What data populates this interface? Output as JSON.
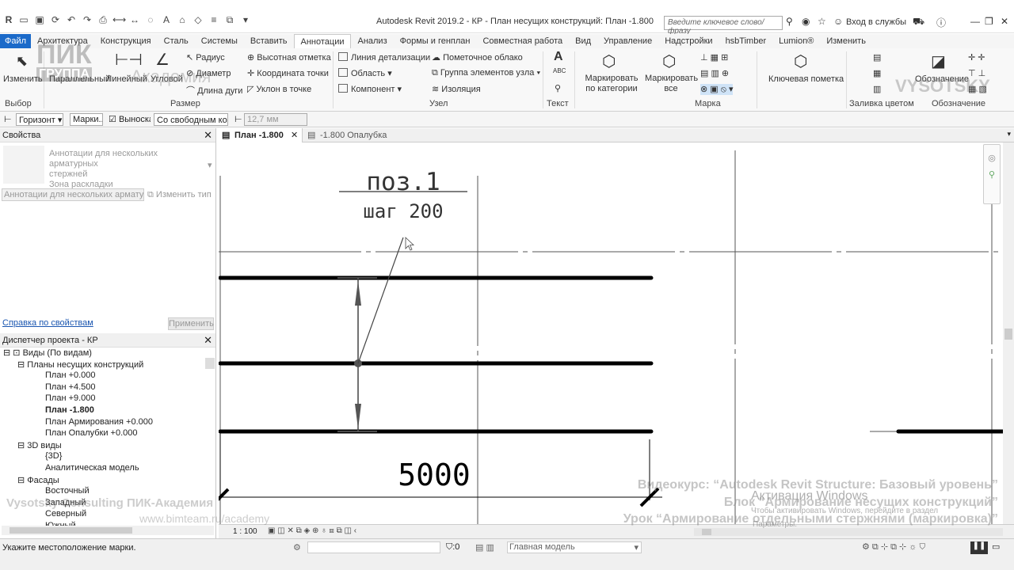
{
  "window": {
    "title": "Autodesk Revit 2019.2 - КР - План несущих конструкций: План -1.800",
    "search_placeholder": "Введите ключевое слово/фразу",
    "login": "Вход в службы"
  },
  "ribbon_tabs": [
    "Файл",
    "Архитектура",
    "Конструкция",
    "Сталь",
    "Системы",
    "Вставить",
    "Аннотации",
    "Анализ",
    "Формы и генплан",
    "Совместная работа",
    "Вид",
    "Управление",
    "Надстройки",
    "hsbTimber",
    "Lumion®",
    "Изменить"
  ],
  "ribbon": {
    "select": {
      "label": "Изменить",
      "section": "Выбор"
    },
    "dimension": {
      "aligned": "Параллельный",
      "linear": "Линейный",
      "angular": "Угловой",
      "radius": "Радиус",
      "diameter": "Диаметр",
      "arc_length": "Длина дуги",
      "spot_elevation": "Высотная отметка",
      "spot_coordinate": "Координата точки",
      "spot_slope": "Уклон в точке",
      "section": "Размер"
    },
    "detail": {
      "detail_line": "Линия детализации",
      "region": "Область",
      "component": "Компонент",
      "revision_cloud": "Пометочное облако",
      "detail_group": "Группа элементов узла",
      "insulation": "Изоляция",
      "section": "Узел"
    },
    "text": {
      "section": "Текст"
    },
    "tag": {
      "by_category": "Маркировать по категории",
      "all": "Маркировать все",
      "section": "Марка"
    },
    "keynote": {
      "label": "Ключевая пометка"
    },
    "color_fill": {
      "section": "Заливка цветом"
    },
    "symbol": {
      "label": "Обозначение",
      "section": "Обозначение"
    }
  },
  "options_bar": {
    "orientation": "Горизонт",
    "tags": "Марки...",
    "leader_label": "Выноска",
    "leader_type": "Со свободным ко",
    "length": "12,7 мм"
  },
  "properties": {
    "title": "Свойства",
    "type_line1": "Аннотации для нескольких арматурных",
    "type_line2": "стержней",
    "type_line3": "Зона раскладки",
    "selector": "Аннотации для нескольких арматур",
    "edit_type": "Изменить тип",
    "help": "Справка по свойствам",
    "apply": "Применить"
  },
  "browser": {
    "title": "Диспетчер проекта - КР",
    "items": [
      "Виды (По видам)",
      "Планы несущих конструкций",
      "План +0.000",
      "План +4.500",
      "План +9.000",
      "План -1.800",
      "План Армирования +0.000",
      "План Опалубки +0.000",
      "3D виды",
      "{3D}",
      "Аналитическая модель",
      "Фасады",
      "Восточный",
      "Западный",
      "Северный",
      "Южный"
    ]
  },
  "view_tabs": [
    "План -1.800",
    "-1.800 Опалубка"
  ],
  "drawing": {
    "tag_top": "поз.1",
    "tag_bottom": "шаг 200",
    "dimension": "5000"
  },
  "view_controls": {
    "scale": "1 : 100"
  },
  "status": {
    "message": "Укажите местоположение марки.",
    "selection_count": ":0",
    "workset": "Главная модель"
  },
  "overlay": {
    "left1": "Vysotsky Consulting  ПИК-Академия",
    "left2": "www.bimteam.ru/academy",
    "right1": "Видеокурс: “Autodesk Revit Structure: Базовый уровень”",
    "right2": "Блок “Армирование несущих конструкций”",
    "right3": "Урок “Армирование отдельными стержнями (маркировка)”",
    "activation": "Активация Windows",
    "activation_sub": "Чтобы активировать Windows, перейдите в раздел",
    "activation_sub2": "Параметры.",
    "logo1": "ПИК",
    "logo2": "ГРУППА",
    "logo3": "Академия",
    "vysotsky": "VYSOTSKY"
  }
}
